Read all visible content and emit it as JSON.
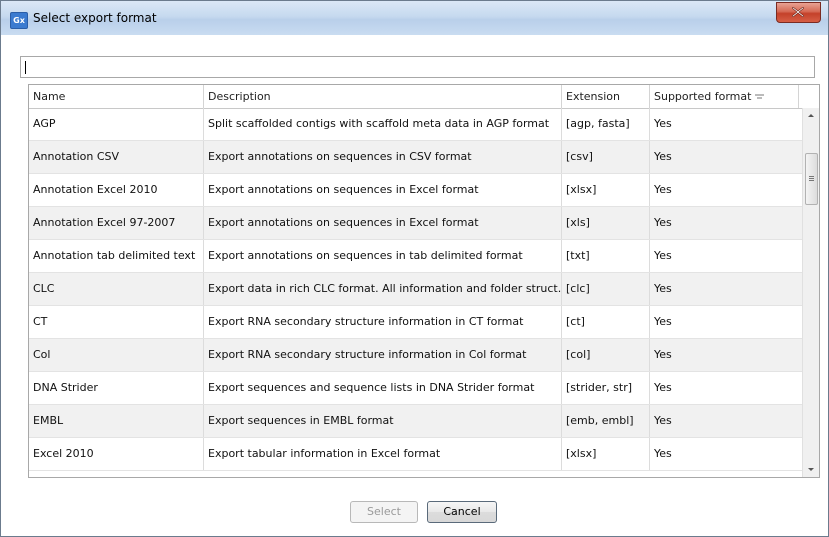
{
  "window": {
    "title": "Select export format",
    "app_icon_text": "Gx"
  },
  "search": {
    "value": ""
  },
  "table": {
    "columns": [
      "Name",
      "Description",
      "Extension",
      "Supported format"
    ],
    "rows": [
      {
        "name": "AGP",
        "description": "Split scaffolded contigs with scaffold meta data in AGP format",
        "extension": "[agp, fasta]",
        "supported": "Yes"
      },
      {
        "name": "Annotation CSV",
        "description": "Export annotations on sequences in CSV format",
        "extension": "[csv]",
        "supported": "Yes"
      },
      {
        "name": "Annotation Excel 2010",
        "description": "Export annotations on sequences in Excel format",
        "extension": "[xlsx]",
        "supported": "Yes"
      },
      {
        "name": "Annotation Excel 97-2007",
        "description": "Export annotations on sequences in Excel format",
        "extension": "[xls]",
        "supported": "Yes"
      },
      {
        "name": "Annotation tab delimited text",
        "description": "Export annotations on sequences in tab delimited format",
        "extension": "[txt]",
        "supported": "Yes"
      },
      {
        "name": "CLC",
        "description": "Export data in rich CLC format. All information and folder struct...",
        "extension": "[clc]",
        "supported": "Yes"
      },
      {
        "name": "CT",
        "description": "Export RNA secondary structure information in CT format",
        "extension": "[ct]",
        "supported": "Yes"
      },
      {
        "name": "Col",
        "description": "Export RNA secondary structure information in Col format",
        "extension": "[col]",
        "supported": "Yes"
      },
      {
        "name": "DNA Strider",
        "description": "Export sequences and sequence lists in DNA Strider format",
        "extension": "[strider, str]",
        "supported": "Yes"
      },
      {
        "name": "EMBL",
        "description": "Export sequences in EMBL format",
        "extension": "[emb, embl]",
        "supported": "Yes"
      },
      {
        "name": "Excel 2010",
        "description": "Export tabular information in Excel format",
        "extension": "[xlsx]",
        "supported": "Yes"
      }
    ]
  },
  "buttons": {
    "select": "Select",
    "cancel": "Cancel"
  },
  "colors": {
    "row_alt": "#f1f1f1",
    "titlebar": "#c6d9ef",
    "close": "#c4412a"
  }
}
